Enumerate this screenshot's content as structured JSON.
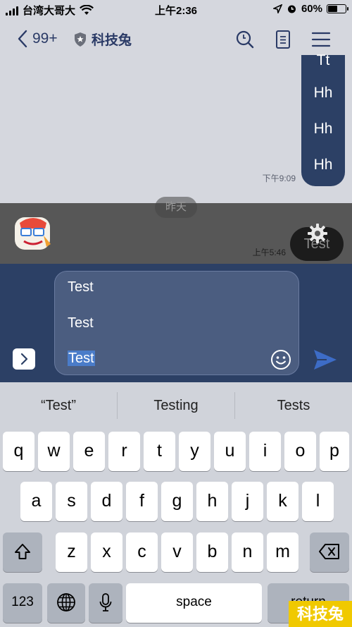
{
  "status_bar": {
    "carrier": "台湾大哥大",
    "time": "上午2:36",
    "battery_percent": "60%",
    "battery_level": 0.6
  },
  "nav": {
    "back_count": "99+",
    "chat_title": "科技兔"
  },
  "chat": {
    "bubble_lines": [
      "Tt",
      "Hh",
      "Hh",
      "Hh"
    ],
    "timestamp_1": "下午9:09",
    "date_separator": "昨天",
    "timestamp_2": "上午5:46",
    "bubble_text": "Test"
  },
  "input": {
    "line1": "Test",
    "line2": "Test",
    "line3_selected": "Test"
  },
  "keyboard": {
    "suggestions": [
      "“Test”",
      "Testing",
      "Tests"
    ],
    "row1": [
      "q",
      "w",
      "e",
      "r",
      "t",
      "y",
      "u",
      "i",
      "o",
      "p"
    ],
    "row2": [
      "a",
      "s",
      "d",
      "f",
      "g",
      "h",
      "j",
      "k",
      "l"
    ],
    "row3": [
      "z",
      "x",
      "c",
      "v",
      "b",
      "n",
      "m"
    ],
    "numbers_label": "123",
    "space_label": "space",
    "return_label": "return"
  },
  "watermark": "科技兔",
  "colors": {
    "nav_accent": "#2a3a66",
    "bubble": "#2c4065",
    "input_box": "#4b5d80",
    "selection": "#4a7cc9",
    "send_arrow": "#3d6cc6",
    "watermark_bg": "#f0c900"
  },
  "icons": {
    "back": "chevron-left-icon",
    "shield": "shield-star-icon",
    "search": "search-icon",
    "notes": "notes-icon",
    "menu": "hamburger-menu-icon",
    "gear": "gear-icon",
    "emoji": "smiley-icon",
    "send": "send-icon",
    "shift": "shift-icon",
    "backspace": "backspace-icon",
    "globe": "globe-icon",
    "mic": "microphone-icon"
  }
}
